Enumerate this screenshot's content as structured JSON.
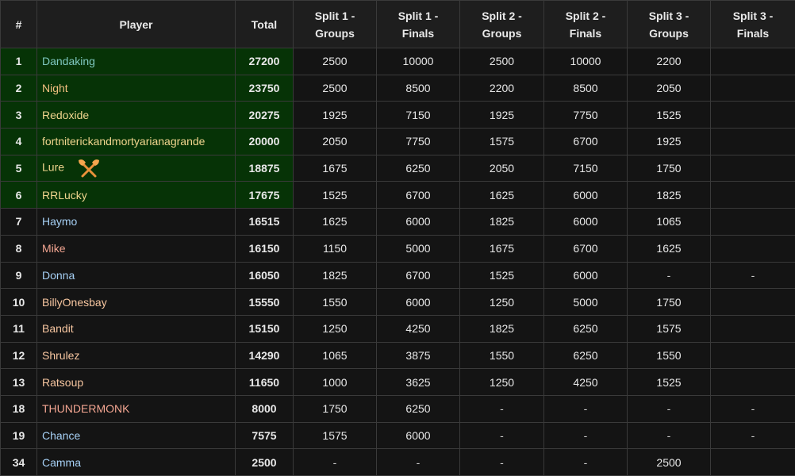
{
  "columns": [
    "#",
    "Player",
    "Total",
    "Split 1 -\nGroups",
    "Split 1 -\nFinals",
    "Split 2 -\nGroups",
    "Split 2 -\nFinals",
    "Split 3 -\nGroups",
    "Split 3 -\nFinals"
  ],
  "colors": {
    "qualified_bg": "#063306",
    "table_bg": "#141414",
    "header_bg": "#1e1e1e",
    "border": "#3a3a3a"
  },
  "rows": [
    {
      "rank": "1",
      "name": "Dandaking",
      "name_color": "teal",
      "total": "27200",
      "s1g": "2500",
      "s1f": "10000",
      "s2g": "2500",
      "s2f": "10000",
      "s3g": "2200",
      "s3f": "",
      "qualified": true
    },
    {
      "rank": "2",
      "name": "Night",
      "name_color": "orange",
      "total": "23750",
      "s1g": "2500",
      "s1f": "8500",
      "s2g": "2200",
      "s2f": "8500",
      "s3g": "2050",
      "s3f": "",
      "qualified": true
    },
    {
      "rank": "3",
      "name": "Redoxide",
      "name_color": "sand",
      "total": "20275",
      "s1g": "1925",
      "s1f": "7150",
      "s2g": "1925",
      "s2f": "7750",
      "s3g": "1525",
      "s3f": "",
      "qualified": true
    },
    {
      "rank": "4",
      "name": "fortniterickandmortyarianagrande",
      "name_color": "sand",
      "total": "20000",
      "s1g": "2050",
      "s1f": "7750",
      "s2g": "1575",
      "s2f": "6700",
      "s3g": "1925",
      "s3f": "",
      "qualified": true
    },
    {
      "rank": "5",
      "name": "Lure",
      "name_color": "sand",
      "icon": "crossed-axes-icon",
      "total": "18875",
      "s1g": "1675",
      "s1f": "6250",
      "s2g": "2050",
      "s2f": "7150",
      "s3g": "1750",
      "s3f": "",
      "qualified": true
    },
    {
      "rank": "6",
      "name": "RRLucky",
      "name_color": "sand",
      "total": "17675",
      "s1g": "1525",
      "s1f": "6700",
      "s2g": "1625",
      "s2f": "6000",
      "s3g": "1825",
      "s3f": "",
      "qualified": true
    },
    {
      "rank": "7",
      "name": "Haymo",
      "name_color": "blue",
      "total": "16515",
      "s1g": "1625",
      "s1f": "6000",
      "s2g": "1825",
      "s2f": "6000",
      "s3g": "1065",
      "s3f": "",
      "qualified": false
    },
    {
      "rank": "8",
      "name": "Mike",
      "name_color": "salmon",
      "total": "16150",
      "s1g": "1150",
      "s1f": "5000",
      "s2g": "1675",
      "s2f": "6700",
      "s3g": "1625",
      "s3f": "",
      "qualified": false
    },
    {
      "rank": "9",
      "name": "Donna",
      "name_color": "blue",
      "total": "16050",
      "s1g": "1825",
      "s1f": "6700",
      "s2g": "1525",
      "s2f": "6000",
      "s3g": "-",
      "s3f": "-",
      "qualified": false
    },
    {
      "rank": "10",
      "name": "BillyOnesbay",
      "name_color": "peach",
      "total": "15550",
      "s1g": "1550",
      "s1f": "6000",
      "s2g": "1250",
      "s2f": "5000",
      "s3g": "1750",
      "s3f": "",
      "qualified": false
    },
    {
      "rank": "11",
      "name": "Bandit",
      "name_color": "peach",
      "total": "15150",
      "s1g": "1250",
      "s1f": "4250",
      "s2g": "1825",
      "s2f": "6250",
      "s3g": "1575",
      "s3f": "",
      "qualified": false
    },
    {
      "rank": "12",
      "name": "Shrulez",
      "name_color": "peach",
      "total": "14290",
      "s1g": "1065",
      "s1f": "3875",
      "s2g": "1550",
      "s2f": "6250",
      "s3g": "1550",
      "s3f": "",
      "qualified": false
    },
    {
      "rank": "13",
      "name": "Ratsoup",
      "name_color": "peach",
      "total": "11650",
      "s1g": "1000",
      "s1f": "3625",
      "s2g": "1250",
      "s2f": "4250",
      "s3g": "1525",
      "s3f": "",
      "qualified": false
    },
    {
      "rank": "18",
      "name": "THUNDERMONK",
      "name_color": "salmon",
      "total": "8000",
      "s1g": "1750",
      "s1f": "6250",
      "s2g": "-",
      "s2f": "-",
      "s3g": "-",
      "s3f": "-",
      "qualified": false
    },
    {
      "rank": "19",
      "name": "Chance",
      "name_color": "blue",
      "total": "7575",
      "s1g": "1575",
      "s1f": "6000",
      "s2g": "-",
      "s2f": "-",
      "s3g": "-",
      "s3f": "-",
      "qualified": false
    },
    {
      "rank": "34",
      "name": "Camma",
      "name_color": "blue",
      "total": "2500",
      "s1g": "-",
      "s1f": "-",
      "s2g": "-",
      "s2f": "-",
      "s3g": "2500",
      "s3f": "",
      "qualified": false
    }
  ]
}
